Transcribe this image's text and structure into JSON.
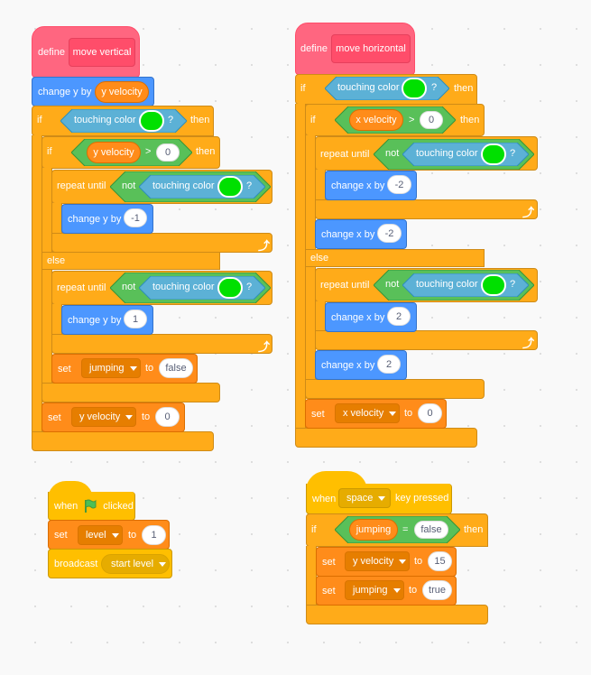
{
  "workspace": "Scratch code area",
  "scripts": {
    "move_vertical": {
      "define_label": "define",
      "proc_name": "move vertical",
      "change_y": {
        "label": "change y by",
        "reporter": "y velocity"
      },
      "if1": {
        "if": "if",
        "touching": "touching color",
        "q": "?",
        "then": "then",
        "color": "#00e000"
      },
      "if2": {
        "if": "if",
        "reporter": "y velocity",
        "op": ">",
        "value": "0",
        "then": "then",
        "else": "else"
      },
      "repeat1": {
        "label": "repeat until",
        "not": "not",
        "touching": "touching color",
        "q": "?"
      },
      "change_y_neg": {
        "label": "change y by",
        "value": "-1"
      },
      "repeat2": {
        "label": "repeat until",
        "not": "not",
        "touching": "touching color",
        "q": "?"
      },
      "change_y_pos": {
        "label": "change y by",
        "value": "1"
      },
      "set_jumping": {
        "set": "set",
        "var": "jumping",
        "to": "to",
        "value": "false"
      },
      "set_yvel": {
        "set": "set",
        "var": "y velocity",
        "to": "to",
        "value": "0"
      }
    },
    "move_horizontal": {
      "define_label": "define",
      "proc_name": "move horizontal",
      "if1": {
        "if": "if",
        "touching": "touching color",
        "q": "?",
        "then": "then"
      },
      "if2": {
        "if": "if",
        "reporter": "x velocity",
        "op": ">",
        "value": "0",
        "then": "then",
        "else": "else"
      },
      "repeat1": {
        "label": "repeat until",
        "not": "not",
        "touching": "touching color",
        "q": "?"
      },
      "change_x_neg_inner": {
        "label": "change x by",
        "value": "-2"
      },
      "change_x_neg": {
        "label": "change x by",
        "value": "-2"
      },
      "repeat2": {
        "label": "repeat until",
        "not": "not",
        "touching": "touching color",
        "q": "?"
      },
      "change_x_pos_inner": {
        "label": "change x by",
        "value": "2"
      },
      "change_x_pos": {
        "label": "change x by",
        "value": "2"
      },
      "set_xvel": {
        "set": "set",
        "var": "x velocity",
        "to": "to",
        "value": "0"
      }
    },
    "green_flag": {
      "when": "when",
      "clicked": "clicked",
      "set_level": {
        "set": "set",
        "var": "level",
        "to": "to",
        "value": "1"
      },
      "broadcast": {
        "label": "broadcast",
        "message": "start level"
      }
    },
    "key_press": {
      "when": "when",
      "key": "space",
      "pressed": "key pressed",
      "if": {
        "if": "if",
        "reporter": "jumping",
        "op": "=",
        "value": "false",
        "then": "then"
      },
      "set_yvel": {
        "set": "set",
        "var": "y velocity",
        "to": "to",
        "value": "15"
      },
      "set_jumping": {
        "set": "set",
        "var": "jumping",
        "to": "to",
        "value": "true"
      }
    }
  }
}
